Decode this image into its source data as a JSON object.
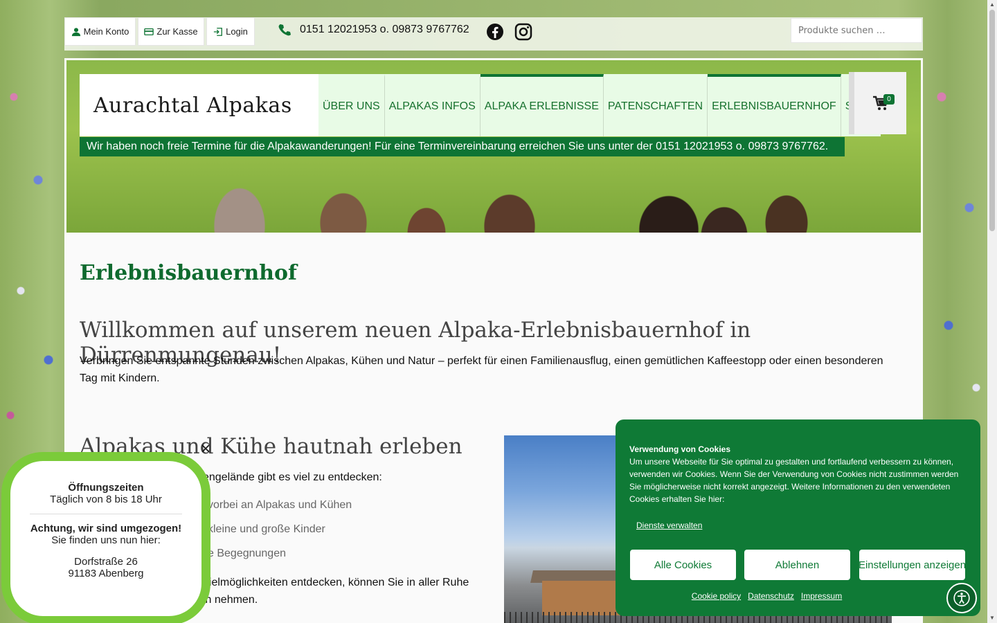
{
  "topbar": {
    "account_label": "Mein Konto",
    "checkout_label": "Zur Kasse",
    "login_label": "Login",
    "phone_text": "0151 12021953 o. 09873 9767762",
    "search_placeholder": "Produkte suchen …",
    "social_icons": [
      "facebook-icon",
      "instagram-icon"
    ]
  },
  "header": {
    "logo_text": "Aurachtal Alpakas",
    "nav": [
      {
        "label": "ÜBER UNS",
        "active": false
      },
      {
        "label": "ALPAKAS INFOS",
        "active": false
      },
      {
        "label": "ALPAKA ERLEBNISSE",
        "active": true
      },
      {
        "label": "PATENSCHAFTEN",
        "active": false
      },
      {
        "label": "ERLEBNISBAUERNHOF",
        "active": true
      },
      {
        "label": "SHOP",
        "active": false
      }
    ],
    "cart_count": "0",
    "notice": "Wir haben noch freie Termine für die Alpakawanderungen! Für eine Terminvereinbarung erreichen Sie uns unter der 0151 12021953 o. 09873 9767762."
  },
  "main": {
    "page_title": "Erlebnisbauernhof",
    "welcome_heading": "Willkommen auf unserem neuen Alpaka-Erlebnisbauernhof in Dürrenmungenau!",
    "intro": "Verbringen Sie entspannte Stunden zwischen Alpakas, Kühen und Natur – perfekt für einen Familienausflug, einen gemütlichen Kaffeestopp oder einen besonderen Tag mit Kindern.",
    "section_heading": "Alpakas und Kühe hautnah erleben",
    "section_intro": "engelände gibt es viel zu entdecken:",
    "features": [
      "vorbei an Alpakas und Kühen",
      "kleine und große Kinder",
      "e Begegnungen"
    ],
    "section_text": "pielmöglichkeiten entdecken, können Sie in aller Ruhe in nehmen."
  },
  "hours_popup": {
    "title": "Öffnungszeiten",
    "hours": "Täglich von 8 bis 18 Uhr",
    "moved_title": "Achtung, wir sind umgezogen!",
    "moved_text": "Sie finden uns nun hier:",
    "street": "Dorfstraße 26",
    "city": "91183 Abenberg",
    "close_symbol": "×"
  },
  "cookie_banner": {
    "title": "Verwendung von Cookies",
    "text": "Um unsere Webseite für Sie optimal zu gestalten und fortlaufend verbessern zu können, verwenden wir Cookies. Wenn Sie der Verwendung von Cookies nicht zustimmen werden Sie möglicherweise nicht korrekt angezeigt. Weitere Informationen zu den verwendeten Cookies erhalten Sie hier:",
    "manage_label": "Dienste verwalten",
    "accept_label": "Alle Cookies",
    "decline_label": "Ablehnen",
    "settings_label": "Einstellungen anzeigen",
    "links": [
      "Cookie policy",
      "Datenschutz",
      "Impressum"
    ]
  },
  "colors": {
    "brand_green": "#0e7434",
    "nav_bg": "#e8fbe6",
    "popup_border": "#7bcb3a"
  }
}
